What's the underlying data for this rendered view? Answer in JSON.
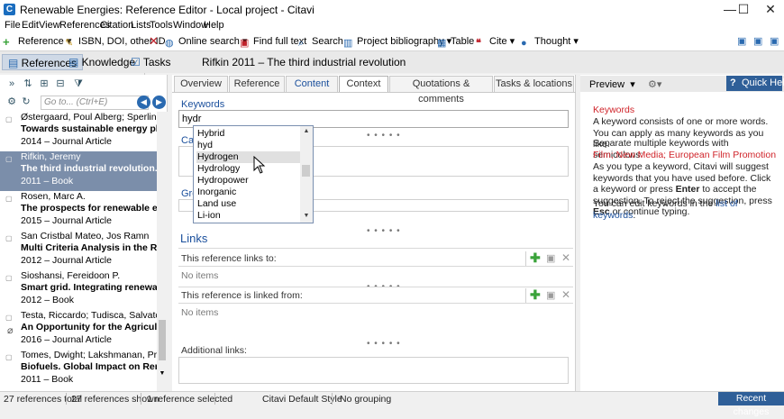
{
  "window": {
    "title": "Renewable Energies: Reference Editor - Local project - Citavi",
    "app_icon": "C"
  },
  "menu": [
    "File",
    "Edit",
    "View",
    "References",
    "Citation",
    "Lists",
    "Tools",
    "Window",
    "Help"
  ],
  "toolbar": {
    "reference": "Reference",
    "isbn": "ISBN, DOI, other ID",
    "online_search": "Online search",
    "find_full_text": "Find full text",
    "search": "Search",
    "project_bibliography": "Project bibliography",
    "table": "Table",
    "cite": "Cite",
    "thought": "Thought"
  },
  "nav": {
    "references": "References",
    "knowledge": "Knowledge",
    "tasks": "Tasks"
  },
  "goto": {
    "placeholder": "Go to... (Ctrl+E)"
  },
  "references": [
    {
      "authors": "Østergaard, Poul Alberg; Sperling, Karl",
      "title": "Towards sustainable energy planning and",
      "meta": "2014 – Journal Article"
    },
    {
      "authors": "Rifkin, Jeremy",
      "title": "The third industrial revolution. How later",
      "meta": "2011 – Book"
    },
    {
      "authors": "Rosen, Marc A.",
      "title": "The prospects for renewable energy thro",
      "meta": "2015 – Journal Article"
    },
    {
      "authors": "San Cristbal Mateo, Jos Ramn",
      "title": "Multi Criteria Analysis in the Renewable E",
      "meta": "2012 – Journal Article"
    },
    {
      "authors": "Sioshansi, Fereidoon P.",
      "title": "Smart grid. Integrating renewable, distri",
      "meta": "2012 – Book"
    },
    {
      "authors": "Testa, Riccardo; Tudisca, Salvatore",
      "title": "An Opportunity for the Agricultural Sect",
      "meta": "2016 – Journal Article"
    },
    {
      "authors": "Tomes, Dwight; Lakshmanan, Prakash; Son",
      "title": "Biofuels. Global Impact on Renewable En",
      "meta": "2011 – Book"
    }
  ],
  "reference_header": "Rifkin 2011 – The third industrial revolution",
  "tabs": [
    "Overview",
    "Reference",
    "Content",
    "Context",
    "Quotations & comments",
    "Tasks & locations"
  ],
  "context": {
    "keywords_label": "Keywords",
    "keywords_value": "hydr",
    "categories_label": "Cat",
    "groups_label": "Gro",
    "suggestions": [
      "Hybrid",
      "hyd",
      "Hydrogen",
      "Hydrology",
      "Hydropower",
      "Inorganic",
      "Land use",
      "Li-ion"
    ],
    "links_title": "Links",
    "links_to_label": "This reference links to:",
    "linked_from_label": "This reference is linked from:",
    "no_items": "No items",
    "additional_links_label": "Additional links:",
    "dots": "• • • • •"
  },
  "right_panel": {
    "preview": "Preview",
    "quick_help": "Quick Help",
    "help_title": "Keywords",
    "p1": "A keyword consists of one or more words. You can apply as many keywords as you like.",
    "p2": "Separate multiple keywords with semicolons:",
    "example": "Film; New Media; European Film Promotion",
    "p3a": "As you type a keyword, Citavi will suggest keywords that you have used before. Click a keyword or press ",
    "enter": "Enter",
    "p3b": " to accept the suggestion. To reject the suggestion, press ",
    "esc": "Esc",
    "p3c": " or continue typing.",
    "p4a": "You can edit keywords in the ",
    "p4link": "list of keywords",
    "p4b": "."
  },
  "status": {
    "total": "27 references total",
    "shown": "27 references shown",
    "selected": "1 reference selected",
    "style": "Citavi Default Style",
    "grouping": "No grouping",
    "recent": "Recent changes"
  },
  "colors": {
    "accent": "#2f5f98",
    "selection": "#7b8eaa",
    "label_blue": "#1a4f9c",
    "red": "#d0242a"
  }
}
